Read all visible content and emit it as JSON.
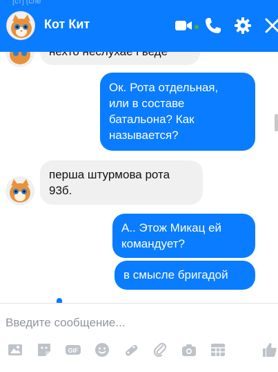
{
  "header": {
    "clipped_text": "[ст] (сле",
    "contact_name": "Кот Кит",
    "color": "#0a7cff"
  },
  "messages": [
    {
      "direction": "incoming",
      "text": "нехто неслухае і веде"
    },
    {
      "direction": "outgoing",
      "text": "Ок. Рота отдельная,\nили в составе\nбатальона? Как\nназывается?"
    },
    {
      "direction": "incoming",
      "text": "перша штурмова рота\n93б."
    },
    {
      "direction": "outgoing",
      "text": "А.. Этож Микац ей\nкомандует?"
    },
    {
      "direction": "outgoing",
      "text": "в смысле бригадой"
    }
  ],
  "composer": {
    "placeholder": "Введите сообщение...",
    "tool_icons": [
      "image-icon",
      "sticker-icon",
      "gif-icon",
      "emoji-icon",
      "game-icon",
      "attachment-icon",
      "camera-icon",
      "table-icon",
      "like-icon"
    ]
  },
  "header_icons": [
    "video-call-icon",
    "phone-icon",
    "gear-icon",
    "close-icon"
  ],
  "colors": {
    "outgoing": "#0a7cff",
    "incoming": "#f1f0f0",
    "icon_gray": "#bec3c9"
  }
}
